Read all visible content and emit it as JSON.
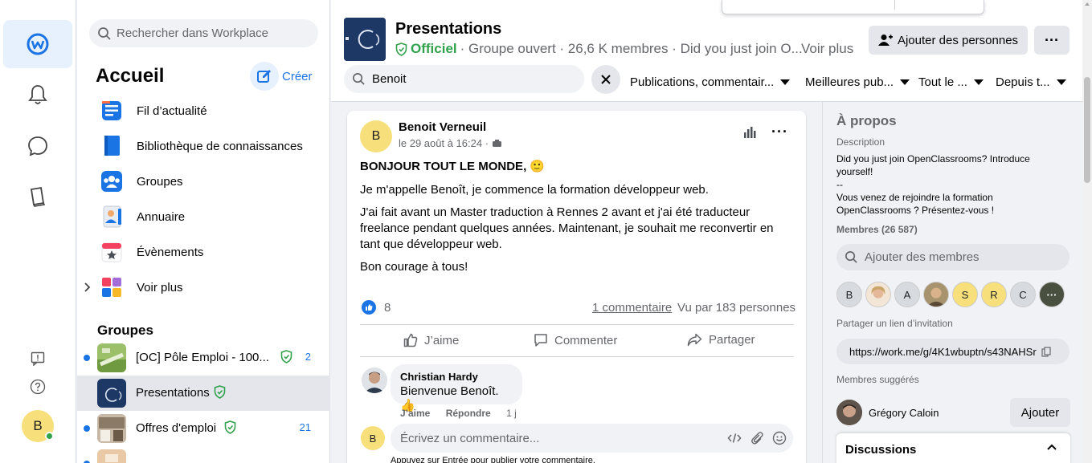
{
  "nav": {
    "search_placeholder": "Rechercher dans Workplace",
    "title": "Accueil",
    "create_label": "Créer",
    "items": [
      {
        "label": "Fil d’actualité",
        "icon": "news-feed-icon"
      },
      {
        "label": "Bibliothèque de connaissances",
        "icon": "knowledge-library-icon"
      },
      {
        "label": "Groupes",
        "icon": "groups-icon"
      },
      {
        "label": "Annuaire",
        "icon": "directory-icon"
      },
      {
        "label": "Évènements",
        "icon": "events-icon"
      },
      {
        "label": "Voir plus",
        "icon": "more-apps-icon"
      }
    ],
    "groups_heading": "Groupes",
    "groups": [
      {
        "label": "[OC] Pôle Emploi - 100...",
        "count": "2",
        "unread": true
      },
      {
        "label": "Presentations",
        "count": "",
        "unread": false,
        "selected": true
      },
      {
        "label": "Offres d'emploi",
        "count": "21",
        "unread": true
      },
      {
        "label": "",
        "count": "",
        "unread": true
      }
    ]
  },
  "rail": {
    "icons": [
      "workplace-logo-icon",
      "notifications-bell-icon",
      "chat-icon",
      "knowledge-book-icon",
      "feedback-icon",
      "help-icon"
    ],
    "user_initial": "B"
  },
  "group": {
    "title": "Presentations",
    "official": "Officiel",
    "meta": "· Groupe ouvert · 26,6 K membres · Did you just join O...",
    "see_more": "Voir plus",
    "add_people": "Ajouter des personnes",
    "more": "···",
    "search_value": "Benoit",
    "filters": [
      "Publications, commentair...",
      "Meilleures pub...",
      "Tout le ...",
      "Depuis t..."
    ]
  },
  "post": {
    "author_initial": "B",
    "author": "Benoit Verneuil",
    "date": "le 29 août à 16:24 ·",
    "heading": "BONJOUR TOUT LE MONDE, 🙂",
    "paragraphs": [
      "Je m'appelle Benoît, je commence la formation développeur web.",
      "J'ai fait avant un Master traduction à Rennes 2 avant et j'ai été traducteur freelance pendant quelques années. Maintenant, je souhait me reconvertir en tant que développeur web.",
      "Bon courage à tous!"
    ],
    "likes": "8",
    "comments_link": "1 commentaire",
    "seen_by": "Vu par 183 personnes",
    "actions": {
      "like": "J’aime",
      "comment": "Commenter",
      "share": "Partager"
    },
    "comment": {
      "author": "Christian Hardy",
      "text": "Bienvenue Benoît. 👍",
      "like": "J’aime",
      "reply": "Répondre",
      "time": "1 j"
    },
    "compose_initial": "B",
    "compose_placeholder": "Écrivez un commentaire...",
    "compose_hint": "Appuyez sur Entrée pour publier votre commentaire."
  },
  "about": {
    "title": "À propos",
    "description_label": "Description",
    "description": "Did you just join OpenClassrooms? Introduce yourself!\n--\nVous venez de rejoindre la formation OpenClassrooms ? Présentez-vous !",
    "members_label": "Membres (26 587)",
    "members_search": "Ajouter des membres",
    "member_initials": [
      "B",
      "",
      "A",
      "",
      "S",
      "R",
      "C",
      "···"
    ],
    "invite_label": "Partager un lien d’invitation",
    "invite_link": "https://work.me/g/4K1wbuptn/s43NAHSr",
    "suggested_label": "Membres suggérés",
    "suggested_name": "Grégory Caloin",
    "suggested_add": "Ajouter",
    "discussions": "Discussions"
  },
  "colors": {
    "accent": "#1b74e4",
    "official": "#31a24c",
    "avatar_yellow": "#f7e07b"
  }
}
